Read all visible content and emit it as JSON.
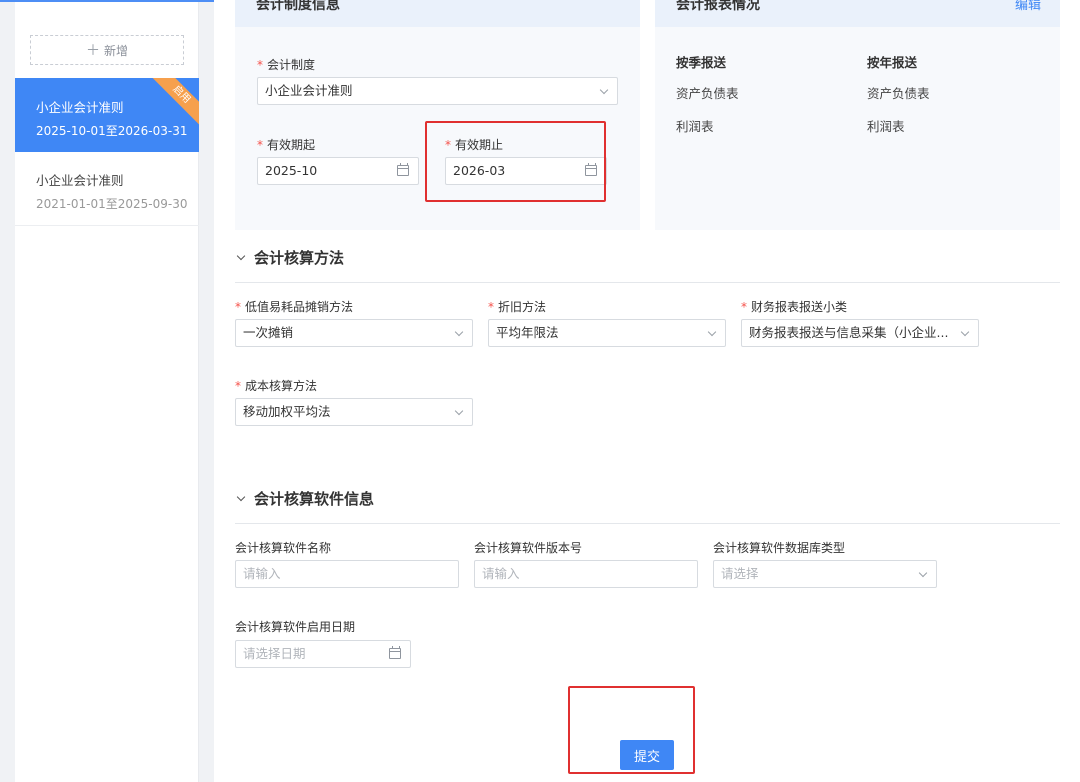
{
  "sidebar": {
    "add_label": "新增",
    "rules": [
      {
        "name": "小企业会计准则",
        "range": "2025-10-01至2026-03-31",
        "badge": "启用",
        "active": true
      },
      {
        "name": "小企业会计准则",
        "range": "2021-01-01至2025-09-30",
        "active": false
      }
    ]
  },
  "system_card": {
    "title": "会计制度信息",
    "system_label": "会计制度",
    "system_value": "小企业会计准则",
    "start_label": "有效期起",
    "start_value": "2025-10",
    "end_label": "有效期止",
    "end_value": "2026-03"
  },
  "report_card": {
    "title": "会计报表情况",
    "edit_label": "编辑",
    "quarterly_head": "按季报送",
    "yearly_head": "按年报送",
    "quarterly_items": [
      "资产负债表",
      "利润表"
    ],
    "yearly_items": [
      "资产负债表",
      "利润表"
    ]
  },
  "method_section": {
    "title": "会计核算方法",
    "low_value_label": "低值易耗品摊销方法",
    "low_value_value": "一次摊销",
    "depreciation_label": "折旧方法",
    "depreciation_value": "平均年限法",
    "report_type_label": "财务报表报送小类",
    "report_type_value": "财务报表报送与信息采集（小企业...",
    "cost_label": "成本核算方法",
    "cost_value": "移动加权平均法"
  },
  "software_section": {
    "title": "会计核算软件信息",
    "name_label": "会计核算软件名称",
    "name_placeholder": "请输入",
    "version_label": "会计核算软件版本号",
    "version_placeholder": "请输入",
    "db_label": "会计核算软件数据库类型",
    "db_placeholder": "请选择",
    "date_label": "会计核算软件启用日期",
    "date_placeholder": "请选择日期"
  },
  "submit_label": "提交",
  "colors": {
    "primary": "#3f87f5",
    "required": "#f5524b",
    "badge": "#f6a04d",
    "highlight": "#e03030"
  }
}
